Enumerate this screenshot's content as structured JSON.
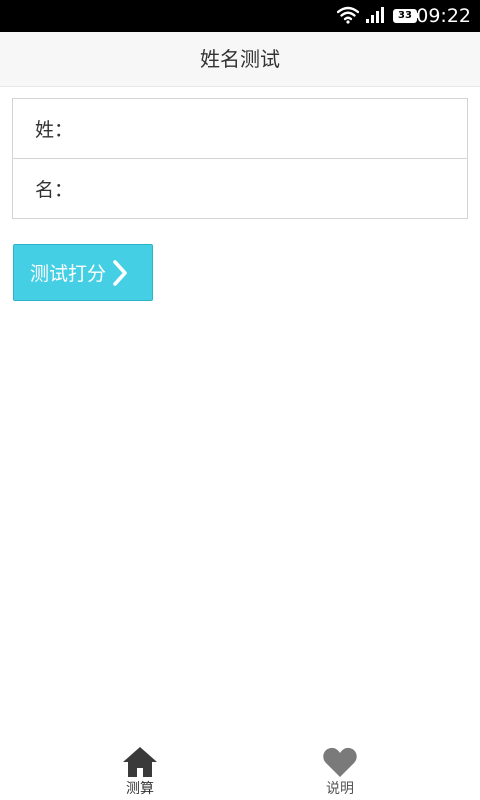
{
  "status_bar": {
    "battery": "33",
    "time": "09:22"
  },
  "header": {
    "title": "姓名测试"
  },
  "form": {
    "surname_label": "姓：",
    "surname_value": "",
    "given_name_label": "名：",
    "given_name_value": ""
  },
  "actions": {
    "score_button_label": "测试打分"
  },
  "bottom_nav": {
    "items": [
      {
        "label": "测算",
        "icon": "home-icon",
        "active": true
      },
      {
        "label": "说明",
        "icon": "heart-icon",
        "active": false
      }
    ]
  },
  "colors": {
    "accent": "#44cfe4",
    "icon_active": "#3a3a3a",
    "icon_inactive": "#7a7a7a"
  }
}
